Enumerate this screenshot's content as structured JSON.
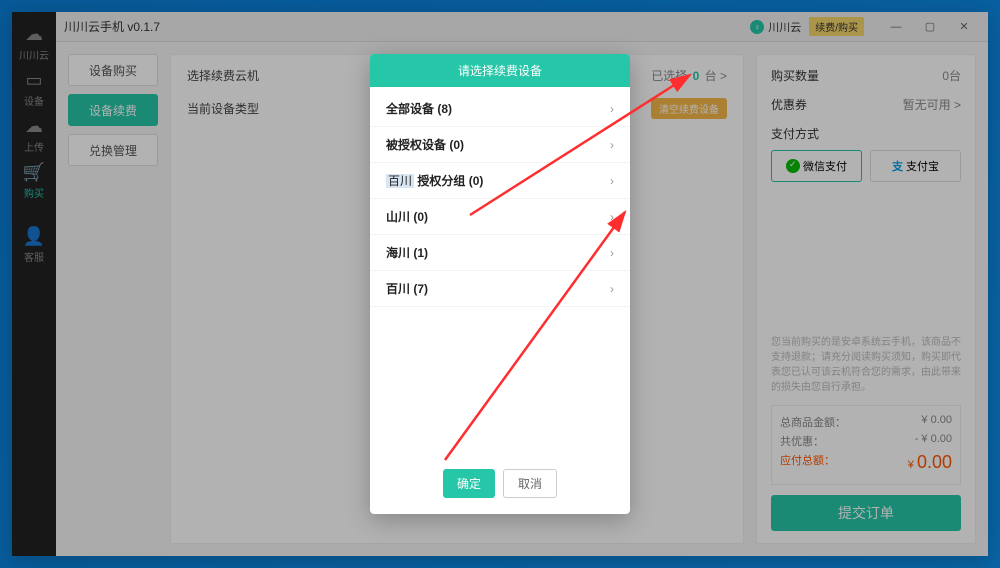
{
  "app": {
    "title": "川川云手机 v0.1.7"
  },
  "titlebar": {
    "user": "川川云",
    "action": "续费/购买"
  },
  "nav": {
    "brand": "川川云",
    "items": [
      {
        "icon": "▭",
        "label": "设备"
      },
      {
        "icon": "☁",
        "label": "上传"
      },
      {
        "icon": "🛒",
        "label": "购买"
      },
      {
        "icon": "👤",
        "label": "客服"
      }
    ],
    "active_index": 2
  },
  "left": {
    "buttons": [
      "设备购买",
      "设备续费",
      "兑换管理"
    ],
    "active_index": 1
  },
  "mid": {
    "row1_label": "选择续费云机",
    "selected_prefix": "已选择",
    "selected_count": "0",
    "selected_suffix": "台 >",
    "row2_label": "当前设备类型",
    "clear_label": "清空续费设备"
  },
  "modal": {
    "title": "请选择续费设备",
    "items": [
      {
        "label": "全部设备",
        "count": "(8)"
      },
      {
        "label": "被授权设备",
        "count": "(0)"
      },
      {
        "prefix": "百川",
        "label": "授权分组",
        "count": "(0)"
      },
      {
        "label": "山川",
        "count": "(0)"
      },
      {
        "label": "海川",
        "count": "(1)"
      },
      {
        "label": "百川",
        "count": "(7)"
      }
    ],
    "ok": "确定",
    "cancel": "取消"
  },
  "right": {
    "qty_label": "购买数量",
    "qty_value": "0台",
    "coupon_label": "优惠券",
    "coupon_value": "暂无可用 >",
    "pay_label": "支付方式",
    "pay_wechat": "微信支付",
    "pay_alipay": "支付宝",
    "note": "您当前购买的是安卓系统云手机，该商品不支持退款；请充分阅读购买须知，购买即代表您已认可该云机符合您的需求，由此带来的损失由您自行承担。",
    "price_label": "总商品金额：",
    "price_value": "¥ 0.00",
    "discount_label": "共优惠：",
    "discount_value": "- ¥ 0.00",
    "total_label": "应付总额：",
    "total_prefix": "¥",
    "total_value": "0.00",
    "submit": "提交订单"
  }
}
